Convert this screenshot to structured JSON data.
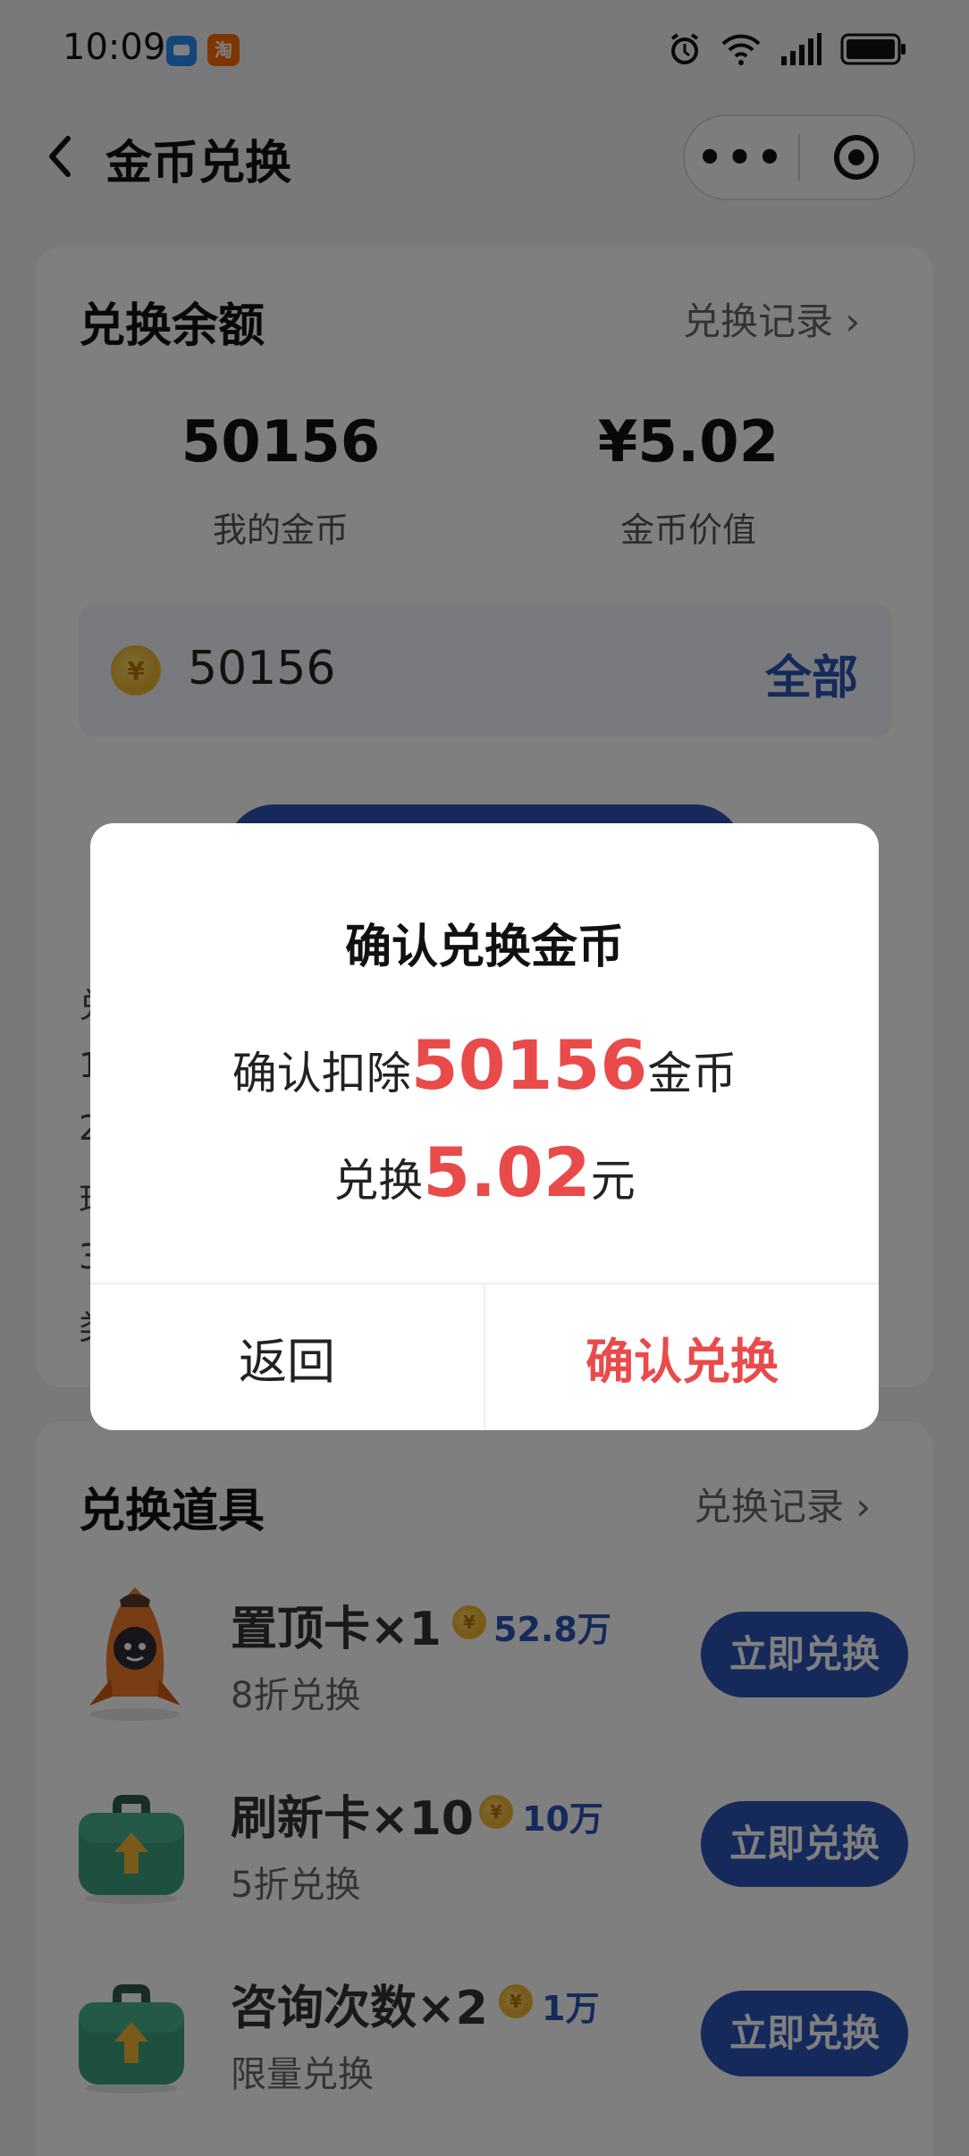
{
  "status_bar": {
    "time": "10:09",
    "app2_badge": "淘"
  },
  "nav": {
    "title": "金币兑换",
    "more_label": "•••"
  },
  "balance": {
    "title": "兑换余额",
    "records_link": "兑换记录 ›",
    "coins_value": "50156",
    "coins_label": "我的金币",
    "worth_value": "¥5.02",
    "worth_label": "金币价值",
    "input_value": "50156",
    "all_button": "全部"
  },
  "rules_partial": [
    "兑",
    "1",
    "2",
    "现",
    "3",
    "类"
  ],
  "props": {
    "title": "兑换道具",
    "records_link": "兑换记录 ›",
    "items": [
      {
        "name": "置顶卡×1",
        "cost": "52.8万",
        "sub": "8折兑换",
        "button": "立即兑换",
        "icon": "rocket-icon"
      },
      {
        "name": "刷新卡×10",
        "cost": "10万",
        "sub": "5折兑换",
        "button": "立即兑换",
        "icon": "briefcase-icon"
      },
      {
        "name": "咨询次数×2",
        "cost": "1万",
        "sub": "限量兑换",
        "button": "立即兑换",
        "icon": "briefcase-icon"
      }
    ]
  },
  "dialog": {
    "title": "确认兑换金币",
    "line1_prefix": "确认扣除",
    "line1_amount": "50156",
    "line1_suffix": "金币",
    "line2_prefix": "兑换",
    "line2_amount": "5.02",
    "line2_suffix": "元",
    "back_button": "返回",
    "confirm_button": "确认兑换"
  },
  "colors": {
    "brand_blue": "#2a54b6",
    "accent_red": "#e94a4a"
  }
}
